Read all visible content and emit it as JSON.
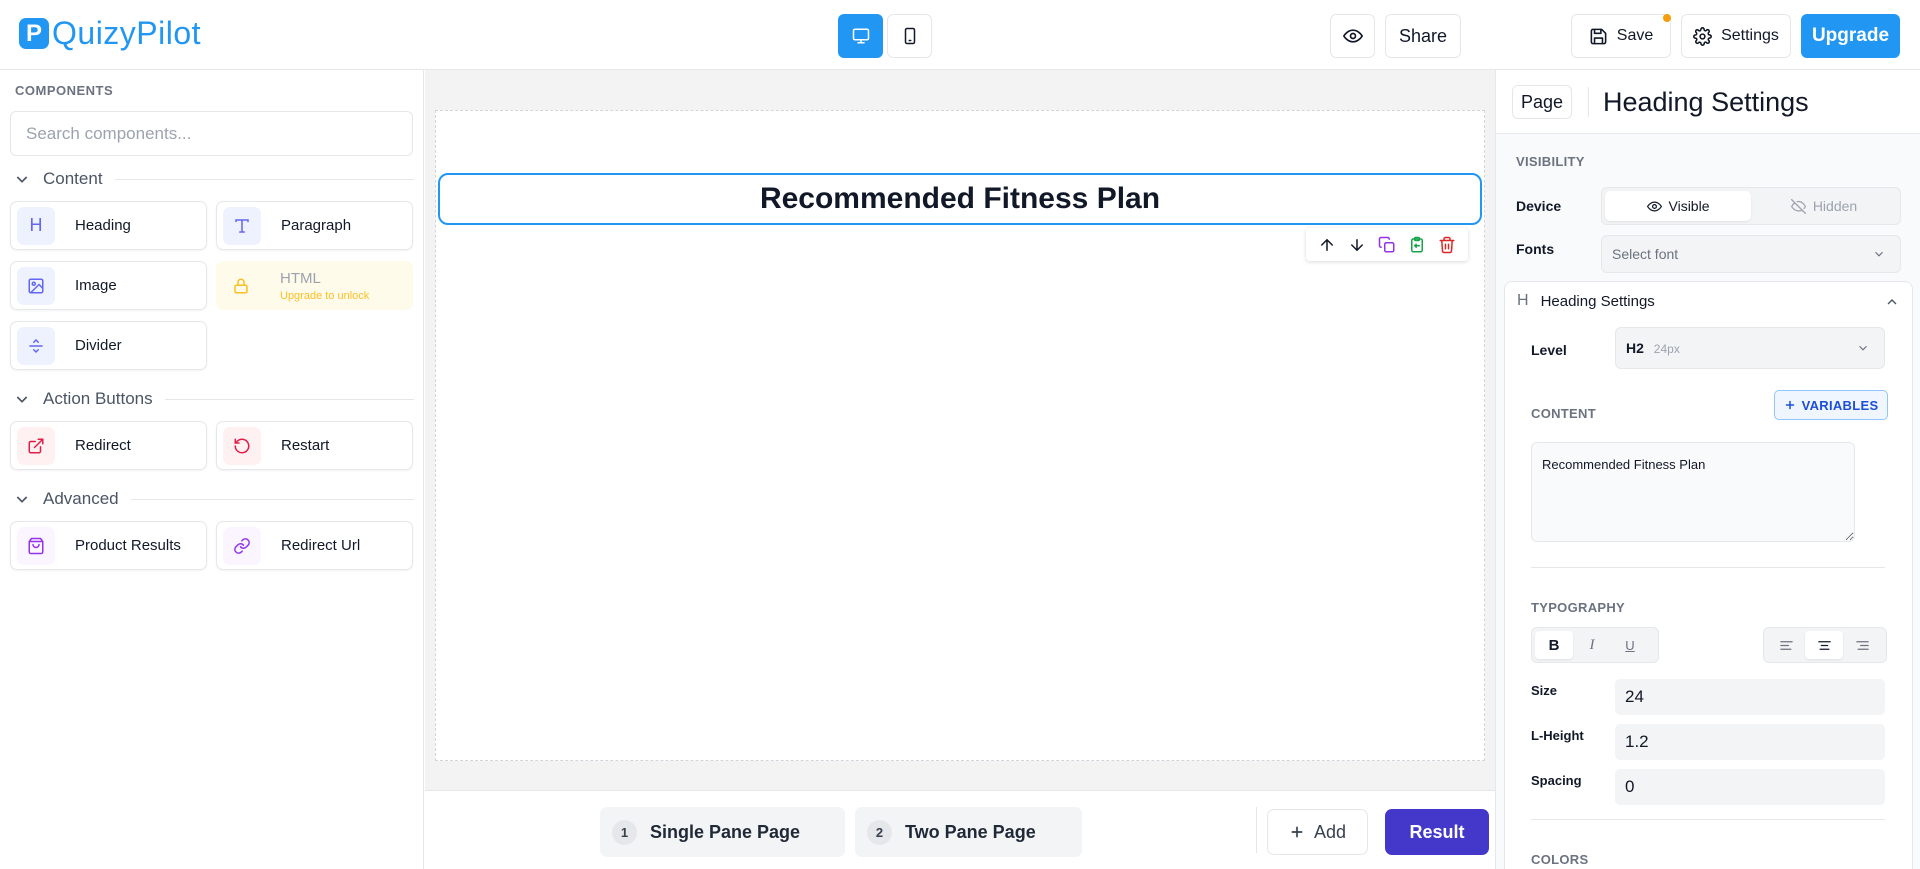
{
  "app": {
    "logo_letter": "P",
    "name": "QuizyPilot"
  },
  "topbar": {
    "device_desktop_icon": "desktop-icon",
    "device_mobile_icon": "mobile-icon",
    "preview_icon": "eye-icon",
    "share_label": "Share",
    "save_label": "Save",
    "settings_label": "Settings",
    "upgrade_label": "Upgrade",
    "accent_color": "#2196f3",
    "unsaved_dot_color": "#f59e0b"
  },
  "sidebar": {
    "heading": "COMPONENTS",
    "search_placeholder": "Search components...",
    "sections": [
      {
        "label": "Content",
        "items": [
          "Heading",
          "Paragraph",
          "Image",
          "HTML",
          "Divider"
        ]
      },
      {
        "label": "Action Buttons",
        "items": [
          "Redirect",
          "Restart"
        ]
      },
      {
        "label": "Advanced",
        "items": [
          "Product Results",
          "Redirect Url"
        ]
      }
    ],
    "locked_sub": "Upgrade to unlock"
  },
  "canvas": {
    "heading_text": "Recommended Fitness Plan"
  },
  "bottombar": {
    "pages": [
      {
        "num": "1",
        "label": "Single Pane Page"
      },
      {
        "num": "2",
        "label": "Two Pane Page"
      }
    ],
    "add_label": "Add",
    "result_label": "Result",
    "result_color": "#4338ca"
  },
  "right_panel": {
    "page_chip": "Page",
    "title": "Heading Settings",
    "visibility_heading": "VISIBILITY",
    "device_label": "Device",
    "visible_label": "Visible",
    "hidden_label": "Hidden",
    "fonts_label": "Fonts",
    "fonts_placeholder": "Select font",
    "card_title": "Heading Settings",
    "level_label": "Level",
    "level_value": "H2",
    "level_hint": "24px",
    "content_heading": "CONTENT",
    "variables_label": "VARIABLES",
    "content_value": "Recommended Fitness Plan",
    "typography_heading": "TYPOGRAPHY",
    "bold": "B",
    "italic": "I",
    "underline": "U",
    "size_label": "Size",
    "size_value": "24",
    "lheight_label": "L-Height",
    "lheight_value": "1.2",
    "spacing_label": "Spacing",
    "spacing_value": "0",
    "colors_heading": "COLORS"
  }
}
